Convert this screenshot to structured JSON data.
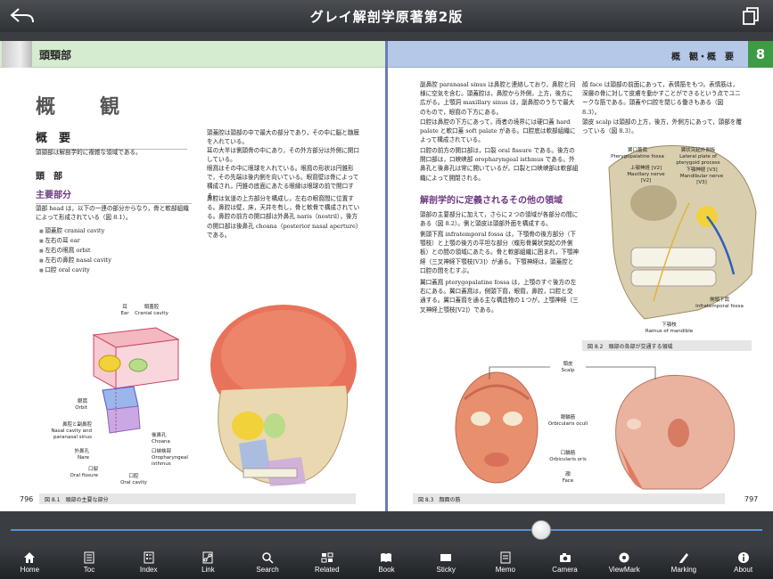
{
  "app": {
    "title": "グレイ解剖学原著第2版"
  },
  "left_page": {
    "section": "頭頸部",
    "title": "概　観",
    "h_summary": "概　要",
    "intro": "頭頸部は解剖学的に複雑な領域である。",
    "h_head": "頭　部",
    "h_main": "主要部分",
    "p1": "頭部 head は，以下の一連の部分からなり，骨と軟部組織によって形成されている（図 8.1）。",
    "list": [
      "頭蓋腔 cranial cavity",
      "左右の耳 ear",
      "左右の眼窩 orbit",
      "左右の鼻腔 nasal cavity",
      "口腔 oral cavity"
    ],
    "col2_p1": "頭蓋腔は頭部の中で最大の部分であり，その中に脳と髄膜を入れている。",
    "col2_p2": "耳の大半は側頭骨の中にあり，その外方部分は外側に開口している。",
    "col2_p3": "眼窩はその中に眼球を入れている。眼窩の形状は円錐形で，その先端は後内側を向いている。眼窩壁は骨によって構成され，円錐の底面にあたる眼縁は眼球の前で開口する。",
    "col2_p4": "鼻腔は気道の上方部分を構成し，左右の眼窩間に位置する。鼻腔は壁，床，天井を有し，骨と軟骨で構成されている。鼻腔の前方の開口部は外鼻孔 naris（nostril），後方の開口部は後鼻孔 choana（posterior nasal aperture）である。",
    "fig_labels": {
      "ear": "耳\nEar",
      "cranial": "頭蓋腔\nCranial cavity",
      "orbit": "眼窩\nOrbit",
      "nasal": "鼻腔と副鼻腔\nNasal cavity and\nparanasal sinus",
      "choana": "後鼻孔\nChoana",
      "nare": "外鼻孔\nNare",
      "oro": "口峡峡部\nOropharyngeal\nisthmus",
      "fissure": "口裂\nOral fissure",
      "oralcav": "口腔\nOral cavity"
    },
    "caption": "図 8.1　頭部の主要な部分",
    "page_number": "796"
  },
  "right_page": {
    "header": "概　観・概　要",
    "chapter": "8",
    "col1_p1": "副鼻腔 paranasal sinus は鼻腔と連絡しており，鼻腔と同様に空気を含む。頭蓋腔は，鼻腔から外側，上方，後方に広がる。上顎洞 maxillary sinus は，副鼻腔のうちで最大のもので，眼窩の下方にある。",
    "col1_p2": "口腔は鼻腔の下方にあって，両者の境界には硬口蓋 hard palate と軟口蓋 soft palate がある。口腔底は軟部組織によって構成されている。",
    "col1_p3": "口腔の前方の開口部は，口裂 oral fissure である。後方の開口部は，口峡峡部 oropharyngeal isthmus である。外鼻孔と後鼻孔は常に開いているが，口裂と口峡峡部は軟部組織によって開閉される。",
    "h_regions": "解剖学的に定義されるその他の領域",
    "col1_p4": "頭部の主要部分に加えて，さらに２つの領域が各部分の間にある（図 8.2）。側と頭皮は頭部外面を構成する。",
    "col1_p5": "側頭下窩 infratemporal fossa は，下顎骨の後方部分（下顎枝）と上顎の後方の平坦な部分（蝶形骨翼状突起の外側板）との間の領域にあたる。骨と軟部組織に囲まれ，下顎神経（三叉神経下顎枝[V3]）が通る。下顎神経は，頭蓋腔と口腔の間をむすぶ。",
    "col1_p6": "翼口蓋窩 pterygopalatine fossa は，上顎のすぐ後方の左右にある。翼口蓋窩は，側頭下窩，眼窩，鼻腔，口腔と交通する。翼口蓋窩を通る主な構造物の１つが，上顎神経（三叉神経上顎枝[V2]）である。",
    "col2_p1": "顔 face は頭部の前面にあって，表情筋をもつ。表情筋は，深層の骨に対して皮膚を動かすことができるという点でユニークな筋である。頭蓋や口腔を閉じる働きもある（図 8.3）。",
    "col2_p2": "頭皮 scalp は頭部の上方，後方，外側方にあって，頭部を覆っている（図 8.3）。",
    "fig2_labels": {
      "ptery": "翼口蓋窩\nPterygopalatine fossa",
      "lateral": "翼状突起外側板\nLateral plate of\npterygoid process",
      "maxn": "上顎神経 [V2]\nMaxillary nerve [V2]",
      "mandn": "下顎神経 [V3]\nMandibular nerve [V3]",
      "infra": "側頭下窩\nInfratemporal fossa",
      "ramus": "下顎枝\nRamus of mandible"
    },
    "caption2": "図 8.2　頭部の各部が交通する領域",
    "fig3_labels": {
      "scalp": "頭皮\nScalp",
      "oculi": "眼輪筋\nOrbicularis oculi",
      "oris": "口輪筋\nOrbicularis oris",
      "face": "顔\nFace"
    },
    "caption3": "図 8.3　顔面の筋",
    "page_number": "797"
  },
  "toolbar": [
    {
      "label": "Home",
      "icon": "home-icon"
    },
    {
      "label": "Toc",
      "icon": "toc-icon"
    },
    {
      "label": "Index",
      "icon": "index-icon"
    },
    {
      "label": "Link",
      "icon": "link-icon"
    },
    {
      "label": "Search",
      "icon": "search-icon"
    },
    {
      "label": "Related",
      "icon": "related-icon"
    },
    {
      "label": "Book",
      "icon": "book-icon"
    },
    {
      "label": "Sticky",
      "icon": "sticky-icon"
    },
    {
      "label": "Memo",
      "icon": "memo-icon"
    },
    {
      "label": "Camera",
      "icon": "camera-icon"
    },
    {
      "label": "ViewMark",
      "icon": "viewmark-icon"
    },
    {
      "label": "Marking",
      "icon": "marking-icon"
    },
    {
      "label": "About",
      "icon": "about-icon"
    }
  ],
  "colors": {
    "left_header": "#d6ecd0",
    "right_header": "#b5c8e8",
    "chapter_tab": "#3f9a45",
    "slider_track": "#5b8fd6"
  }
}
